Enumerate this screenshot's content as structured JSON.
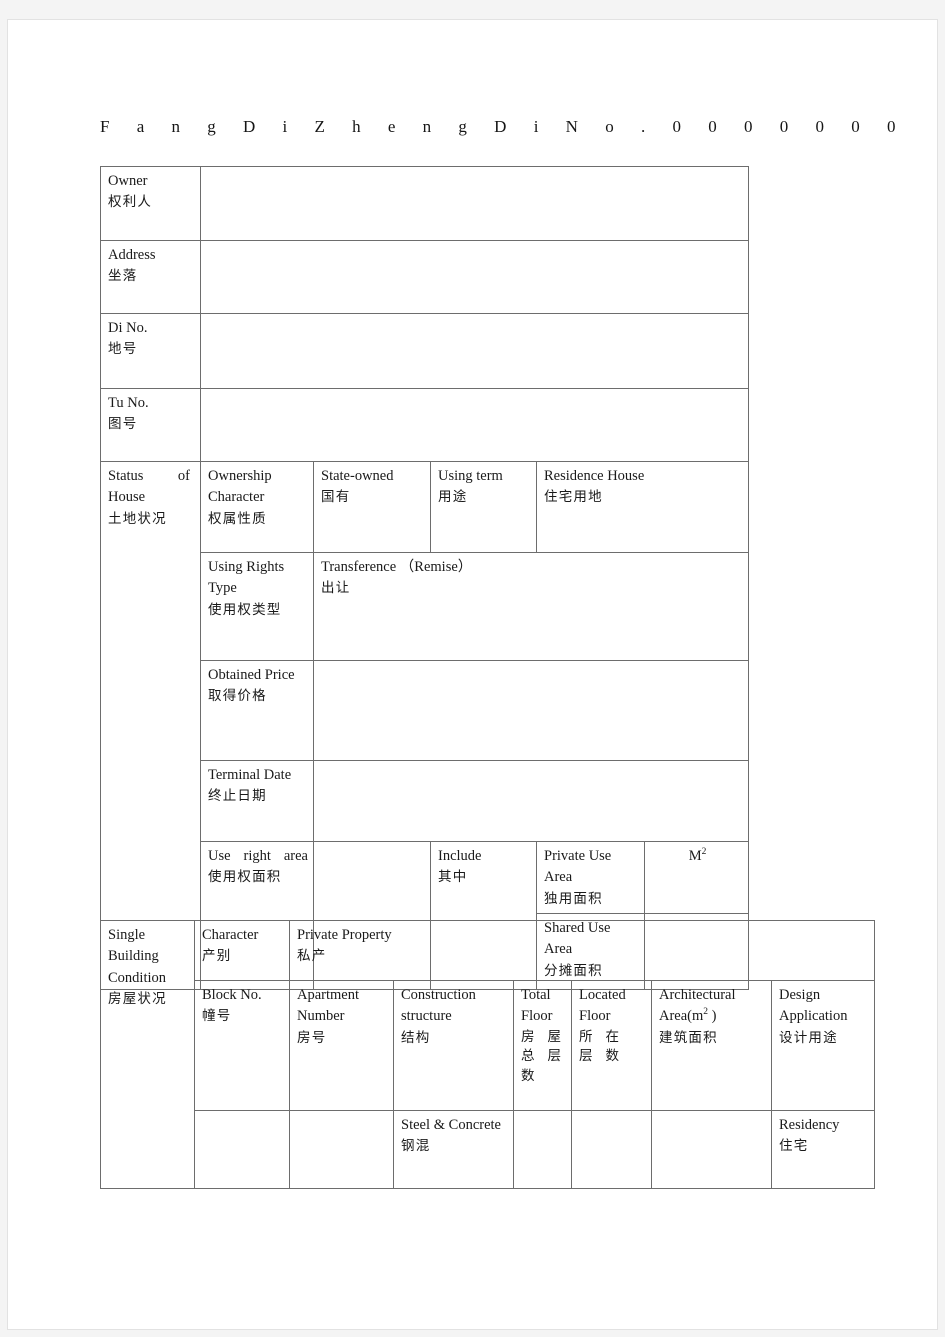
{
  "document": {
    "title": "F a n g   D i   Z h e n g   D i   N o .   0 0 0 0 0 0 0",
    "title_plain": "Fang Di Zheng Di No. 0000000"
  },
  "land_table": {
    "rows": {
      "owner": {
        "en": "Owner",
        "cn": "权利人",
        "value": ""
      },
      "address": {
        "en": "Address",
        "cn": "坐落",
        "value": ""
      },
      "di_no": {
        "en": "Di No.",
        "cn": "地号",
        "value": ""
      },
      "tu_no": {
        "en": "Tu No.",
        "cn": "图号",
        "value": ""
      }
    },
    "section": {
      "en": "Status   of House",
      "cn": "土地状况"
    },
    "ownership_character": {
      "label_en": "Ownership Character",
      "label_cn": "权属性质",
      "value_en": "State-owned",
      "value_cn": "国有"
    },
    "using_term": {
      "label_en": "Using term",
      "label_cn": "用途",
      "value_en": "Residence House",
      "value_cn": "住宅用地"
    },
    "using_rights_type": {
      "label_en": "Using Rights Type",
      "label_cn": "使用权类型",
      "value_en": "Transference  （Remise）",
      "value_cn": "出让"
    },
    "obtained_price": {
      "label_en": "Obtained Price",
      "label_cn": "取得价格",
      "value": ""
    },
    "terminal_date": {
      "label_en": "Terminal Date",
      "label_cn": "终止日期",
      "value": ""
    },
    "use_right_area": {
      "label_en": "Use   right area",
      "label_cn": "使用权面积",
      "value": "",
      "include_en": "Include",
      "include_cn": "其中",
      "private_use_en": "Private Use Area",
      "private_use_cn": "独用面积",
      "private_use_value": "M2",
      "shared_use_en": "Shared Use Area",
      "shared_use_cn": "分摊面积",
      "shared_use_value": ""
    }
  },
  "building_table": {
    "section": {
      "en": "Single Building Condition",
      "cn": "房屋状况"
    },
    "character": {
      "label_en": "Character",
      "label_cn": "产别",
      "value_en": "Private Property",
      "value_cn": "私产"
    },
    "headers": [
      {
        "en": "Block No.",
        "cn": "幢号"
      },
      {
        "en": "Apartment Number",
        "cn": "房号"
      },
      {
        "en": "Construction structure",
        "cn": "结构"
      },
      {
        "en": "Total Floor",
        "cn": "房屋总层数"
      },
      {
        "en": "Located Floor",
        "cn": "所在层数"
      },
      {
        "en": "Architectural Area(m2 )",
        "cn": "建筑面积"
      },
      {
        "en": "Design Application",
        "cn": "设计用途"
      }
    ],
    "values": [
      {
        "en": "",
        "cn": ""
      },
      {
        "en": "",
        "cn": ""
      },
      {
        "en": "Steel   &amp; Concrete",
        "cn": "钢混"
      },
      {
        "en": "",
        "cn": ""
      },
      {
        "en": "",
        "cn": ""
      },
      {
        "en": "",
        "cn": ""
      },
      {
        "en": " Residency",
        "cn": "住宅"
      }
    ]
  }
}
